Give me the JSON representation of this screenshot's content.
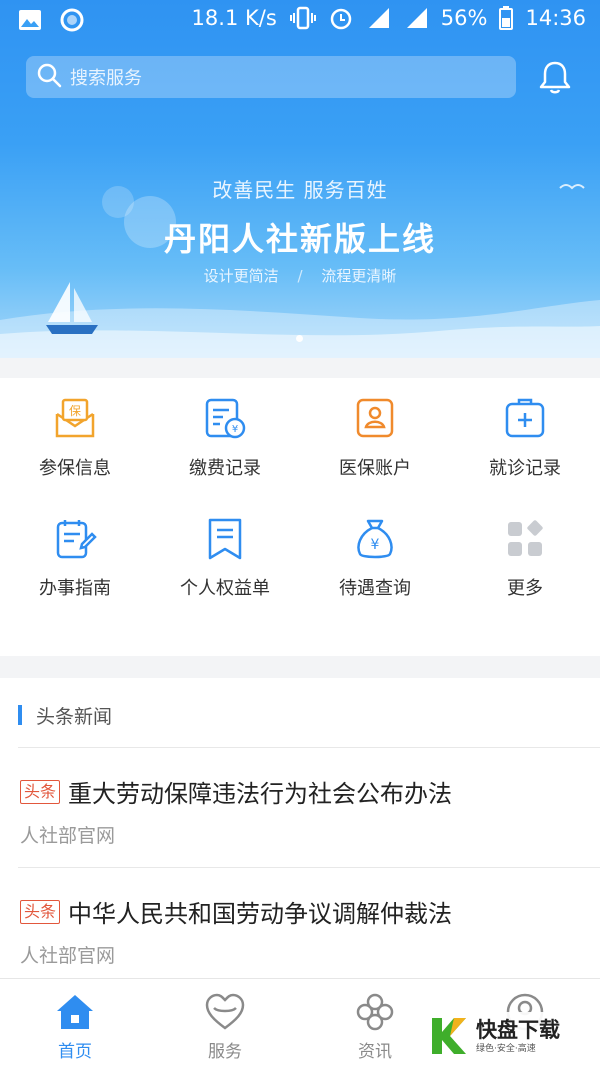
{
  "status_bar": {
    "speed": "18.1 K/s",
    "network": "4G",
    "battery": "56%",
    "time": "14:36"
  },
  "search": {
    "placeholder": "搜索服务"
  },
  "banner": {
    "subtitle": "改善民生 服务百姓",
    "title": "丹阳人社新版上线",
    "tag1": "设计更简洁",
    "separator": "/",
    "tag2": "流程更清晰"
  },
  "services": [
    {
      "label": "参保信息",
      "icon": "insurance-envelope-icon",
      "color": "#f2a42c"
    },
    {
      "label": "缴费记录",
      "icon": "payment-record-icon",
      "color": "#2f8df0"
    },
    {
      "label": "医保账户",
      "icon": "medical-account-icon",
      "color": "#f08a2c"
    },
    {
      "label": "就诊记录",
      "icon": "medical-kit-icon",
      "color": "#2f8df0"
    },
    {
      "label": "办事指南",
      "icon": "guide-icon",
      "color": "#2f8df0"
    },
    {
      "label": "个人权益单",
      "icon": "bookmark-icon",
      "color": "#2f8df0"
    },
    {
      "label": "待遇查询",
      "icon": "money-bag-icon",
      "color": "#2f8df0"
    },
    {
      "label": "更多",
      "icon": "more-grid-icon",
      "color": "#c9ccd1"
    }
  ],
  "news": {
    "heading": "头条新闻",
    "items": [
      {
        "tag": "头条",
        "title": "重大劳动保障违法行为社会公布办法",
        "source": "人社部官网"
      },
      {
        "tag": "头条",
        "title": "中华人民共和国劳动争议调解仲裁法",
        "source": "人社部官网"
      }
    ]
  },
  "tabs": [
    {
      "label": "首页",
      "icon": "home-icon",
      "active": true
    },
    {
      "label": "服务",
      "icon": "heart-icon",
      "active": false
    },
    {
      "label": "资讯",
      "icon": "clover-icon",
      "active": false
    }
  ],
  "watermark": {
    "title": "快盘下载",
    "subtitle": "绿色·安全·高速"
  },
  "colors": {
    "primary": "#2f8df0",
    "tag": "#e2573c",
    "header_top": "#2f93f2"
  }
}
